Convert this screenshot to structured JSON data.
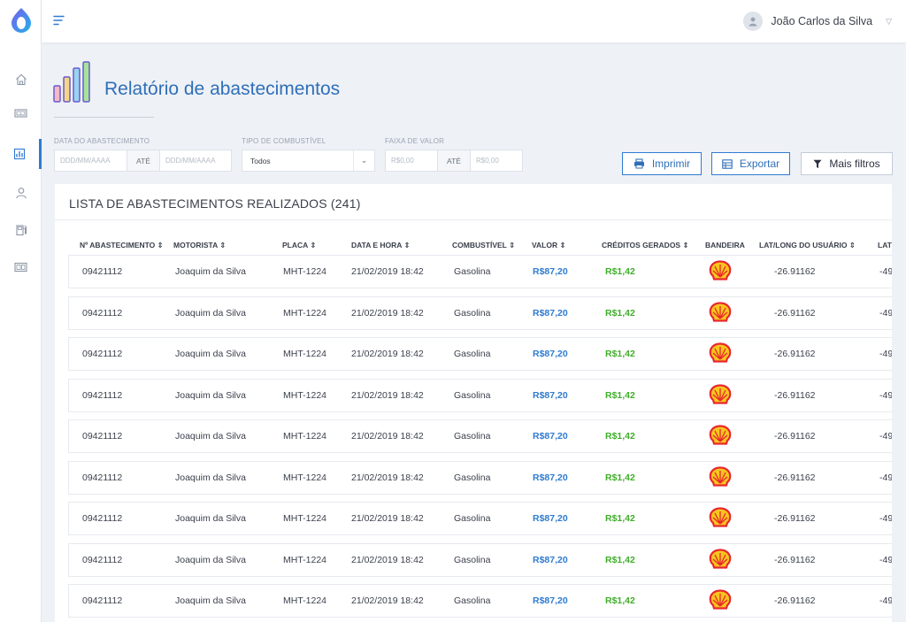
{
  "topbar": {
    "user_name": "João Carlos da Silva"
  },
  "page": {
    "title": "Relatório de abastecimentos"
  },
  "filters": {
    "date_label": "DATA DO ABASTECIMENTO",
    "date_from_placeholder": "DDD/MM/AAAA",
    "date_to_placeholder": "DDD/MM/AAAA",
    "ate_label": "ATÉ",
    "fuel_label": "TIPO DE COMBUSTÍVEL",
    "fuel_value": "Todos",
    "value_label": "FAIXA DE VALOR",
    "value_from_placeholder": "R$0,00",
    "value_to_placeholder": "R$0,00"
  },
  "actions": {
    "print_label": "Imprimir",
    "export_label": "Exportar",
    "more_filters_label": "Mais filtros"
  },
  "list": {
    "title": "LISTA DE ABASTECIMENTOS REALIZADOS (241)",
    "columns": [
      "Nº ABASTECIMENTO ⇕",
      "MOTORISTA ⇕",
      "PLACA ⇕",
      "DATA E HORA ⇕",
      "COMBUSTÍVEL ⇕",
      "VALOR ⇕",
      "CRÉDITOS GERADOS ⇕",
      "BANDEIRA",
      "LAT/LONG DO USUÁRIO ⇕",
      "LAT"
    ],
    "rows": [
      {
        "id": "09421112",
        "driver": "Joaquim da Silva",
        "plate": "MHT-1224",
        "datetime": "21/02/2019 18:42",
        "fuel": "Gasolina",
        "value": "R$87,20",
        "credits": "R$1,42",
        "lat": "-26.91162",
        "long": "-49"
      },
      {
        "id": "09421112",
        "driver": "Joaquim da Silva",
        "plate": "MHT-1224",
        "datetime": "21/02/2019 18:42",
        "fuel": "Gasolina",
        "value": "R$87,20",
        "credits": "R$1,42",
        "lat": "-26.91162",
        "long": "-49"
      },
      {
        "id": "09421112",
        "driver": "Joaquim da Silva",
        "plate": "MHT-1224",
        "datetime": "21/02/2019 18:42",
        "fuel": "Gasolina",
        "value": "R$87,20",
        "credits": "R$1,42",
        "lat": "-26.91162",
        "long": "-49"
      },
      {
        "id": "09421112",
        "driver": "Joaquim da Silva",
        "plate": "MHT-1224",
        "datetime": "21/02/2019 18:42",
        "fuel": "Gasolina",
        "value": "R$87,20",
        "credits": "R$1,42",
        "lat": "-26.91162",
        "long": "-49"
      },
      {
        "id": "09421112",
        "driver": "Joaquim da Silva",
        "plate": "MHT-1224",
        "datetime": "21/02/2019 18:42",
        "fuel": "Gasolina",
        "value": "R$87,20",
        "credits": "R$1,42",
        "lat": "-26.91162",
        "long": "-49"
      },
      {
        "id": "09421112",
        "driver": "Joaquim da Silva",
        "plate": "MHT-1224",
        "datetime": "21/02/2019 18:42",
        "fuel": "Gasolina",
        "value": "R$87,20",
        "credits": "R$1,42",
        "lat": "-26.91162",
        "long": "-49"
      },
      {
        "id": "09421112",
        "driver": "Joaquim da Silva",
        "plate": "MHT-1224",
        "datetime": "21/02/2019 18:42",
        "fuel": "Gasolina",
        "value": "R$87,20",
        "credits": "R$1,42",
        "lat": "-26.91162",
        "long": "-49"
      },
      {
        "id": "09421112",
        "driver": "Joaquim da Silva",
        "plate": "MHT-1224",
        "datetime": "21/02/2019 18:42",
        "fuel": "Gasolina",
        "value": "R$87,20",
        "credits": "R$1,42",
        "lat": "-26.91162",
        "long": "-49"
      },
      {
        "id": "09421112",
        "driver": "Joaquim da Silva",
        "plate": "MHT-1224",
        "datetime": "21/02/2019 18:42",
        "fuel": "Gasolina",
        "value": "R$87,20",
        "credits": "R$1,42",
        "lat": "-26.91162",
        "long": "-49"
      }
    ]
  },
  "sidebar": {
    "items": [
      {
        "icon": "home-icon"
      },
      {
        "icon": "money-icon"
      },
      {
        "icon": "reports-icon",
        "active": true
      },
      {
        "icon": "user-icon"
      },
      {
        "icon": "fuel-pump-icon"
      },
      {
        "icon": "card-icon"
      }
    ]
  },
  "colors": {
    "primary": "#2f7bd1",
    "title": "#2f6fb8",
    "credits": "#3fae2a",
    "background": "#eef1f6",
    "shell_red": "#e8282d",
    "shell_yellow": "#f7c51e"
  },
  "icons": {
    "brand": "shell-logo-icon",
    "print": "printer-icon",
    "export": "table-icon",
    "more_filters": "filter-icon",
    "menu": "hamburger-icon"
  }
}
